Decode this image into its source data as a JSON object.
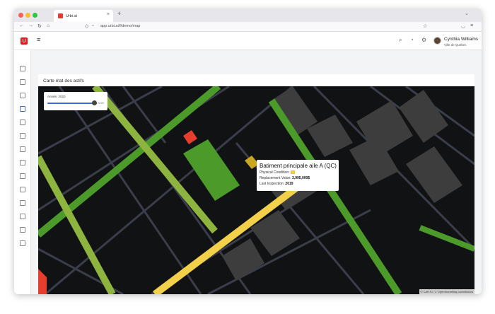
{
  "browser": {
    "tab_title": "Urbi.ai",
    "url": "app.urbi.ai/f/demo/map"
  },
  "app": {
    "logo_letter": "U",
    "user_name": "Cynthia Williams",
    "user_org": "Ville de Québec"
  },
  "page": {
    "card_title": "Carte état des actifs"
  },
  "slider": {
    "label": "Année: 2020",
    "end_label": "2020",
    "value_fraction": 0.95
  },
  "popup": {
    "title": "Batiment principale aile A (QC)",
    "condition_label": "Physical Condition:",
    "condition_value": "3",
    "replacement_label": "Replacement Value:",
    "replacement_value": "3,995,000$",
    "inspection_label": "Last Inspection:",
    "inspection_value": "2019"
  },
  "map": {
    "attribution": "© CARTO, © OpenStreetMap contributors",
    "colors": {
      "background": "#111214",
      "minor_road": "#3a3d4a",
      "good": "#4c9a2a",
      "fair": "#8db43e",
      "average": "#f2d04a",
      "poor": "#e53e2e",
      "building": "#3d3d3d"
    }
  },
  "sidebar": {
    "icons": [
      "calendar-icon",
      "sync-icon",
      "clipboard-icon",
      "map-icon",
      "tree-icon",
      "calendar-alt-icon",
      "chat-icon",
      "grid-icon",
      "folder-icon",
      "mail-icon",
      "document-icon",
      "image-icon",
      "box-icon",
      "folder-alt-icon"
    ]
  }
}
